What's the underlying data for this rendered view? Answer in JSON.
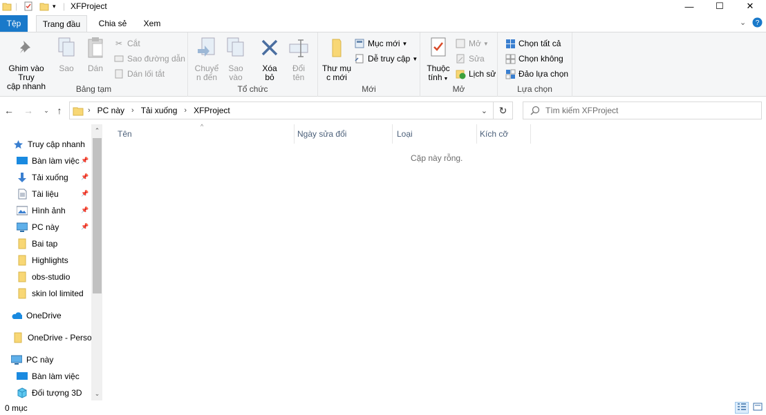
{
  "window": {
    "title": "XFProject",
    "controls": {
      "minimize": "—",
      "maximize": "☐",
      "close": "✕"
    }
  },
  "ribbon_tabs": {
    "file": "Tệp",
    "home": "Trang đầu",
    "share": "Chia sẻ",
    "view": "Xem"
  },
  "ribbon": {
    "clipboard": {
      "label": "Bảng tạm",
      "pin_line1": "Ghim vào Truy",
      "pin_line2": "cập nhanh",
      "copy": "Sao",
      "paste": "Dán",
      "cut": "Cắt",
      "copy_path": "Sao đường dẫn",
      "paste_shortcut": "Dán lối tắt"
    },
    "organize": {
      "label": "Tổ chức",
      "move_line1": "Chuyể",
      "move_line2": "n đến",
      "copyto_line1": "Sao",
      "copyto_line2": "vào",
      "delete_line1": "Xóa",
      "delete_line2": "bỏ",
      "rename_line1": "Đổi",
      "rename_line2": "tên"
    },
    "new": {
      "label": "Mới",
      "folder_line1": "Thư mụ",
      "folder_line2": "c mới",
      "new_item": "Mục mới",
      "easy_access": "Dễ truy cập"
    },
    "open": {
      "label": "Mở",
      "props_line1": "Thuộc",
      "props_line2": "tính",
      "open": "Mở",
      "edit": "Sửa",
      "history": "Lịch sử"
    },
    "select": {
      "label": "Lựa chọn",
      "select_all": "Chọn tất cả",
      "select_none": "Chọn không",
      "invert": "Đảo lựa chọn"
    }
  },
  "address": {
    "crumbs": [
      "PC này",
      "Tải xuống",
      "XFProject"
    ]
  },
  "search": {
    "placeholder": "Tìm kiếm XFProject"
  },
  "nav": {
    "quick_access": "Truy cập nhanh",
    "items": [
      "Bàn làm việc",
      "Tải xuống",
      "Tài liệu",
      "Hình ảnh",
      "PC này",
      "Bai tap",
      "Highlights",
      "obs-studio",
      "skin lol limited"
    ],
    "onedrive": "OneDrive",
    "onedrive_personal": "OneDrive - Persor",
    "this_pc": "PC này",
    "pc_items": [
      "Bàn làm việc",
      "Đối tượng 3D"
    ]
  },
  "columns": {
    "name": "Tên",
    "date": "Ngày sửa đổi",
    "type": "Loại",
    "size": "Kích cỡ"
  },
  "empty_message": "Cặp này rỗng.",
  "status": {
    "count": "0 mục"
  },
  "colors": {
    "accent": "#1979ca",
    "folder": "#f8d775",
    "header_text": "#4c607a"
  }
}
